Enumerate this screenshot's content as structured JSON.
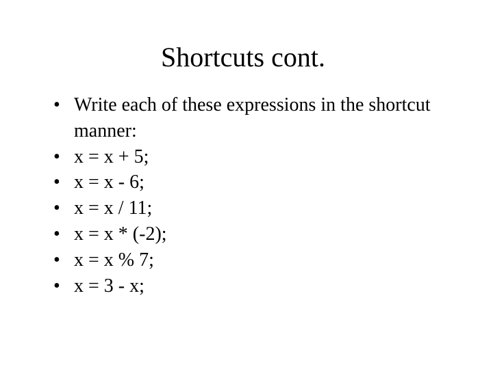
{
  "title": "Shortcuts cont.",
  "items": [
    "Write each of these expressions in the shortcut manner:",
    "x = x + 5;",
    "x = x - 6;",
    "x = x / 11;",
    "x = x * (-2);",
    "x = x % 7;",
    " x = 3 - x;"
  ]
}
